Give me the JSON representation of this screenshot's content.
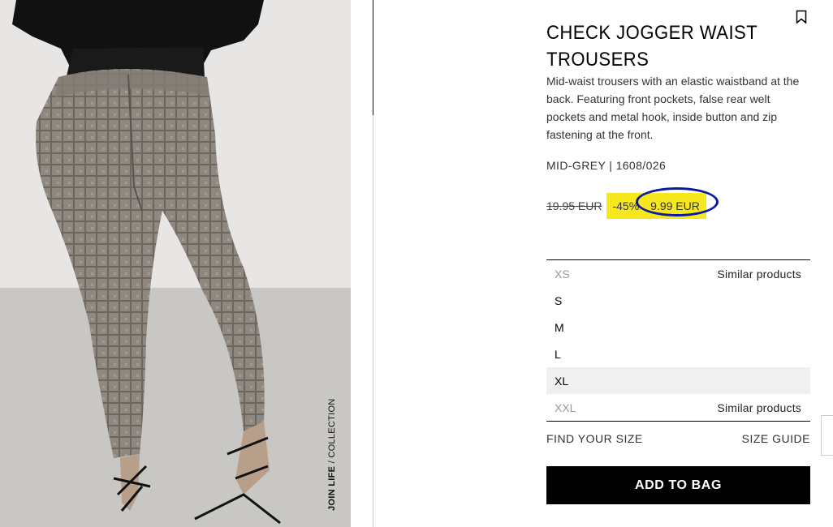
{
  "product": {
    "title": "CHECK JOGGER WAIST TROUSERS",
    "description": "Mid-waist trousers with an elastic waistband at the back. Featuring front pockets, false rear welt pockets and metal hook, inside button and zip fastening at the front.",
    "color_ref": "MID-GREY | 1608/026",
    "old_price": "19.95 EUR",
    "discount": "-45%",
    "price": "9.99 EUR",
    "highlight_color": "#f7e81e",
    "circle_color": "#0a1aa0"
  },
  "photo_caption": {
    "brand": "JOIN LIFE",
    "suffix": " / COLLECTION"
  },
  "sizes": [
    {
      "label": "XS",
      "note": "Similar products",
      "state": "unavailable"
    },
    {
      "label": "S",
      "note": "",
      "state": "available"
    },
    {
      "label": "M",
      "note": "",
      "state": "available"
    },
    {
      "label": "L",
      "note": "",
      "state": "available"
    },
    {
      "label": "XL",
      "note": "",
      "state": "selected"
    },
    {
      "label": "XXL",
      "note": "Similar products",
      "state": "unavailable"
    }
  ],
  "links": {
    "find_size": "FIND YOUR SIZE",
    "size_guide": "SIZE GUIDE"
  },
  "actions": {
    "add_to_bag": "ADD TO BAG"
  },
  "icons": {
    "bookmark": "bookmark-icon"
  }
}
